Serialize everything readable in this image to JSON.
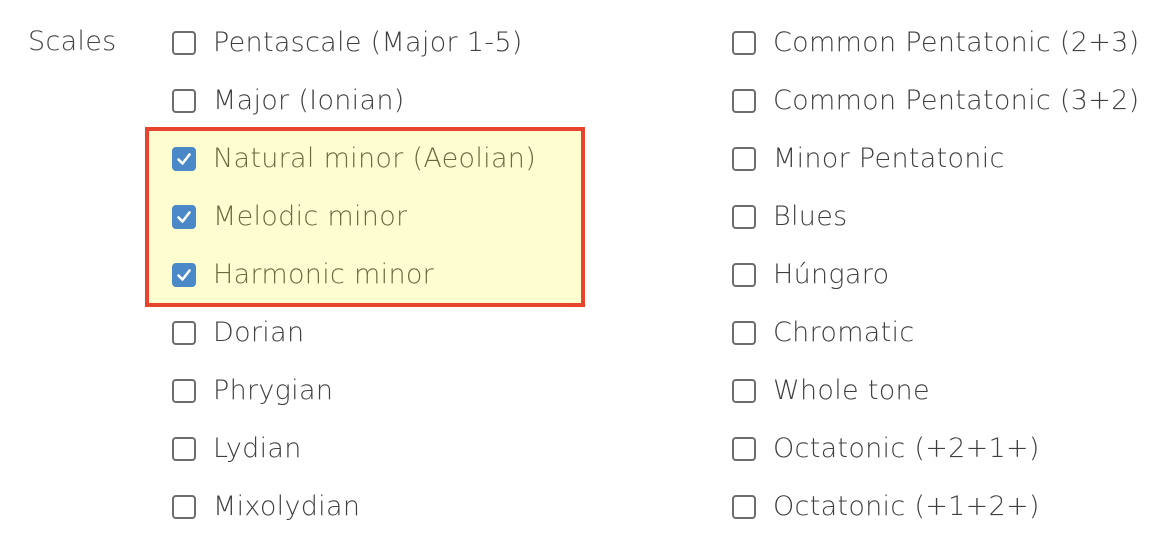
{
  "section": {
    "label": "Scales"
  },
  "options_left": [
    {
      "label": "Pentascale (Major 1-5)",
      "checked": false
    },
    {
      "label": "Major (Ionian)",
      "checked": false
    },
    {
      "label": "Natural minor (Aeolian)",
      "checked": true
    },
    {
      "label": "Melodic minor",
      "checked": true
    },
    {
      "label": "Harmonic minor",
      "checked": true
    },
    {
      "label": "Dorian",
      "checked": false
    },
    {
      "label": "Phrygian",
      "checked": false
    },
    {
      "label": "Lydian",
      "checked": false
    },
    {
      "label": "Mixolydian",
      "checked": false
    }
  ],
  "options_right": [
    {
      "label": "Common Pentatonic (2+3)",
      "checked": false
    },
    {
      "label": "Common Pentatonic (3+2)",
      "checked": false
    },
    {
      "label": "Minor Pentatonic",
      "checked": false
    },
    {
      "label": "Blues",
      "checked": false
    },
    {
      "label": "Húngaro",
      "checked": false
    },
    {
      "label": "Chromatic",
      "checked": false
    },
    {
      "label": "Whole tone",
      "checked": false
    },
    {
      "label": "Octatonic (+2+1+)",
      "checked": false
    },
    {
      "label": "Octatonic (+1+2+)",
      "checked": false
    }
  ],
  "colors": {
    "checkbox_checked": "#4a88c7",
    "highlight_fill": "#fdfdd0",
    "highlight_border": "#e8442d",
    "text": "#3f3f3f"
  },
  "icons": {
    "checkmark": "checkmark-icon"
  }
}
